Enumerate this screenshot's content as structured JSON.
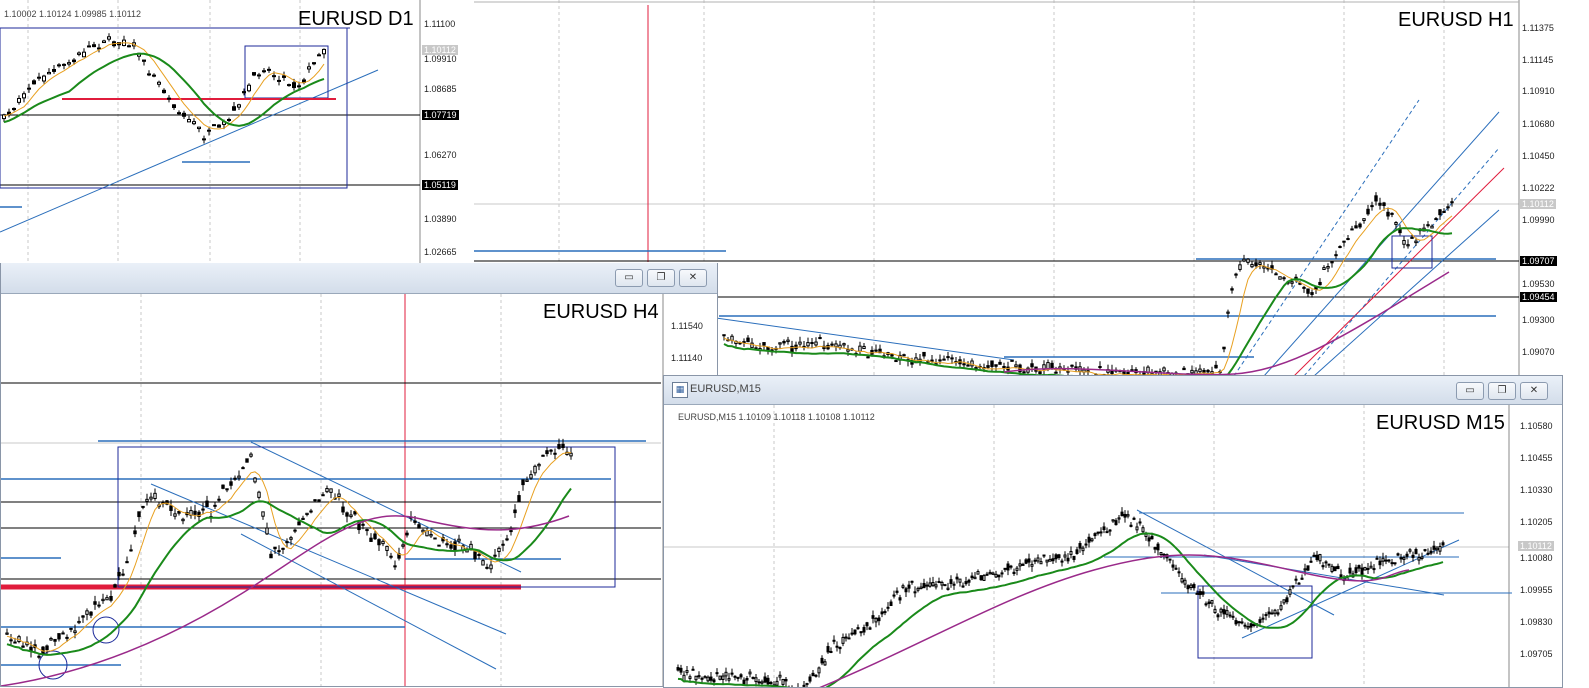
{
  "panels": {
    "d1": {
      "title": "EURUSD D1",
      "ohlc": "1.10002 1.10124 1.09985 1.10112",
      "price_labels": [
        "1.11100",
        "1.10112",
        "1.09910",
        "1.08685",
        "1.07719",
        "1.06270",
        "1.05119",
        "1.03890",
        "1.02665"
      ]
    },
    "h1": {
      "title": "EURUSD H1",
      "price_labels": [
        "1.11375",
        "1.11145",
        "1.10910",
        "1.10680",
        "1.10450",
        "1.10222",
        "1.10112",
        "1.09990",
        "1.09707",
        "1.09530",
        "1.09454",
        "1.09300",
        "1.09070"
      ]
    },
    "h4": {
      "title": "EURUSD H4",
      "price_labels": [
        "1.11540",
        "1.11140"
      ],
      "buttons": {
        "minimize": "▭",
        "restore": "❐",
        "close": "✕"
      }
    },
    "m15": {
      "window_caption": "EURUSD,M15",
      "title": "EURUSD M15",
      "ohlc": "EURUSD,M15  1.10109 1.10118 1.10108 1.10112",
      "price_labels": [
        "1.10580",
        "1.10455",
        "1.10330",
        "1.10205",
        "1.10112",
        "1.10080",
        "1.09955",
        "1.09830",
        "1.09705"
      ],
      "buttons": {
        "minimize": "▭",
        "restore": "❐",
        "close": "✕"
      }
    }
  },
  "colors": {
    "candle": "#000000",
    "ma_fast": "#e8a020",
    "ma_mid": "#1a8a1a",
    "ma_slow": "#9a2a8a",
    "trend_line": "#2a6ebb",
    "support_red": "#e01c3c",
    "box_blue": "#1c2a9a",
    "grid": "#c8c8c8"
  }
}
